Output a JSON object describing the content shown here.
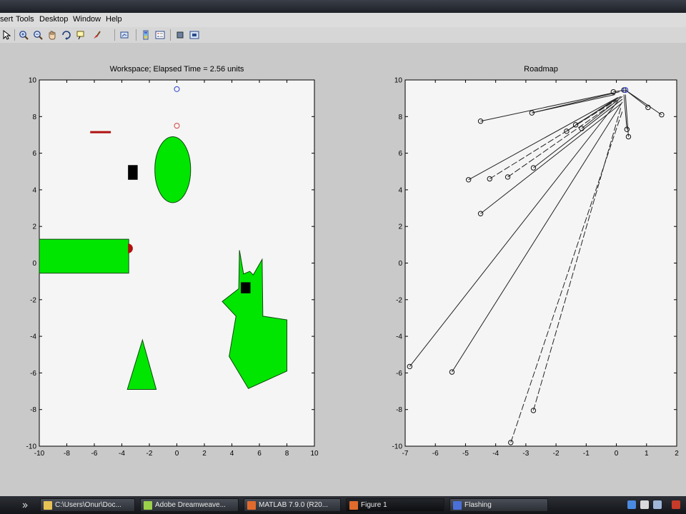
{
  "menu": {
    "items": [
      {
        "label": "sert"
      },
      {
        "label": "Tools"
      },
      {
        "label": "Desktop"
      },
      {
        "label": "Window"
      },
      {
        "label": "Help"
      }
    ]
  },
  "toolbar": {
    "buttons": [
      {
        "icon": "arrow-pointer-icon"
      },
      {
        "icon": "zoom-in-icon"
      },
      {
        "icon": "zoom-out-icon"
      },
      {
        "icon": "pan-hand-icon"
      },
      {
        "icon": "rotate-3d-icon"
      },
      {
        "icon": "data-cursor-icon"
      },
      {
        "icon": "brush-icon"
      },
      {
        "icon": "link-plot-icon"
      },
      {
        "icon": "colorbar-icon"
      },
      {
        "icon": "legend-icon"
      },
      {
        "icon": "hide-plot-tools-icon"
      },
      {
        "icon": "show-plot-tools-icon"
      }
    ]
  },
  "colors": {
    "obstacle": "#00e600",
    "block": "#000000",
    "robot": "#b01010",
    "goal": "#3040d0",
    "start": "#d04040",
    "axes_bg": "#f4f5f4",
    "figure_bg": "#c9c9c9"
  },
  "chart_data": [
    {
      "type": "scatter",
      "title": "Workspace; Elapsed Time = 2.56 units",
      "xlim": [
        -10,
        10
      ],
      "ylim": [
        -10,
        10
      ],
      "xticks": [
        -10,
        -8,
        -6,
        -4,
        -2,
        0,
        2,
        4,
        6,
        8,
        10
      ],
      "yticks": [
        -10,
        -8,
        -6,
        -4,
        -2,
        0,
        2,
        4,
        6,
        8,
        10
      ],
      "grid": false,
      "obstacles": [
        {
          "shape": "ellipse",
          "center": [
            -0.3,
            5.1
          ],
          "radii": [
            1.3,
            1.8
          ]
        },
        {
          "shape": "polygon",
          "points": [
            [
              -10,
              1.3
            ],
            [
              -3.5,
              1.3
            ],
            [
              -3.5,
              -0.55
            ],
            [
              -10,
              -0.55
            ]
          ]
        },
        {
          "shape": "polygon",
          "points": [
            [
              -3.6,
              -6.9
            ],
            [
              -2.5,
              -4.2
            ],
            [
              -1.5,
              -6.9
            ]
          ]
        },
        {
          "shape": "polygon",
          "points": [
            [
              4.55,
              0.7
            ],
            [
              4.85,
              -0.6
            ],
            [
              5.3,
              -0.45
            ],
            [
              5.55,
              -0.65
            ],
            [
              6.2,
              0.2
            ],
            [
              6.25,
              -2.9
            ],
            [
              8.0,
              -3.1
            ],
            [
              8.0,
              -5.9
            ],
            [
              5.2,
              -6.85
            ],
            [
              3.8,
              -5.1
            ],
            [
              4.3,
              -2.9
            ],
            [
              3.3,
              -2.1
            ],
            [
              4.5,
              -1.4
            ]
          ]
        }
      ],
      "blocks": [
        {
          "center": [
            -3.2,
            4.95
          ],
          "size": [
            0.7,
            0.8
          ]
        },
        {
          "center": [
            5.0,
            -1.35
          ],
          "size": [
            0.7,
            0.6
          ]
        }
      ],
      "robots": [
        {
          "shape": "segment",
          "from": [
            -6.3,
            7.15
          ],
          "to": [
            -4.8,
            7.15
          ]
        },
        {
          "shape": "half-disc",
          "center": [
            -3.55,
            0.8
          ],
          "radius": 0.35
        }
      ],
      "markers": [
        {
          "name": "goal",
          "x": 0.0,
          "y": 9.5
        },
        {
          "name": "start",
          "x": 0.0,
          "y": 7.5
        }
      ]
    },
    {
      "type": "line",
      "title": "Roadmap",
      "xlim": [
        -7,
        2
      ],
      "ylim": [
        -10,
        10
      ],
      "xticks": [
        -7,
        -6,
        -5,
        -4,
        -3,
        -2,
        -1,
        0,
        1,
        2
      ],
      "yticks": [
        -10,
        -8,
        -6,
        -4,
        -2,
        0,
        2,
        4,
        6,
        8,
        10
      ],
      "grid": false,
      "hub": [
        0.3,
        9.45
      ],
      "nodes": [
        {
          "x": -4.5,
          "y": 7.75
        },
        {
          "x": -2.8,
          "y": 8.2
        },
        {
          "x": -4.9,
          "y": 4.55
        },
        {
          "x": -4.2,
          "y": 4.6
        },
        {
          "x": -3.6,
          "y": 4.7
        },
        {
          "x": -2.75,
          "y": 5.2
        },
        {
          "x": -4.5,
          "y": 2.7
        },
        {
          "x": -1.65,
          "y": 7.2
        },
        {
          "x": -1.35,
          "y": 7.55
        },
        {
          "x": -1.15,
          "y": 7.35
        },
        {
          "x": -6.85,
          "y": -5.65
        },
        {
          "x": -5.45,
          "y": -5.95
        },
        {
          "x": -2.75,
          "y": -8.05
        },
        {
          "x": -3.5,
          "y": -9.8
        },
        {
          "x": 1.05,
          "y": 8.5
        },
        {
          "x": 1.5,
          "y": 8.1
        },
        {
          "x": 0.35,
          "y": 7.3
        },
        {
          "x": 0.4,
          "y": 6.9
        },
        {
          "x": -0.1,
          "y": 9.35
        },
        {
          "x": 0.25,
          "y": 9.45
        }
      ],
      "edges": [
        {
          "from": 0,
          "to": [
            -0.1,
            9.3
          ],
          "dash": false
        },
        {
          "from": 1,
          "to": [
            0.1,
            9.35
          ],
          "dash": false
        },
        {
          "from": 1,
          "to": [
            -0.05,
            9.2
          ],
          "dash": false
        },
        {
          "from": 2,
          "to": [
            0.0,
            9.0
          ],
          "dash": false
        },
        {
          "from": 3,
          "to": [
            0.0,
            8.9
          ],
          "dash": true
        },
        {
          "from": 4,
          "to": [
            0.1,
            8.95
          ],
          "dash": true
        },
        {
          "from": 5,
          "to": [
            0.2,
            8.95
          ],
          "dash": false
        },
        {
          "from": 6,
          "to": [
            0.15,
            8.7
          ],
          "dash": false
        },
        {
          "from": 7,
          "to": [
            0.05,
            9.05
          ],
          "dash": false
        },
        {
          "from": 8,
          "to": [
            0.15,
            9.1
          ],
          "dash": false
        },
        {
          "from": 9,
          "to": [
            0.2,
            9.1
          ],
          "dash": false
        },
        {
          "from": 10,
          "to": [
            0.05,
            8.85
          ],
          "dash": false
        },
        {
          "from": 11,
          "to": [
            0.2,
            8.8
          ],
          "dash": false
        },
        {
          "from": 12,
          "to": [
            0.15,
            8.5
          ],
          "dash": true
        },
        {
          "from": 13,
          "to": [
            0.2,
            8.3
          ],
          "dash": true
        },
        {
          "from": 14,
          "to": [
            0.3,
            9.45
          ],
          "dash": false
        },
        {
          "from": 15,
          "to": [
            0.3,
            9.45
          ],
          "dash": false
        },
        {
          "from": 16,
          "to": [
            0.25,
            9.2
          ],
          "dash": false
        },
        {
          "from": 17,
          "to": [
            0.3,
            9.2
          ],
          "dash": false
        },
        {
          "from": 18,
          "to": [
            0.3,
            9.45
          ],
          "dash": false
        }
      ],
      "hub_marker": {
        "x": 0.3,
        "y": 9.45
      }
    }
  ],
  "taskbar": {
    "items": [
      {
        "label": "C:\\Users\\Onur\\Doc...",
        "color": "#e6c255"
      },
      {
        "label": "Adobe Dreamweave...",
        "color": "#9ad04a"
      },
      {
        "label": "MATLAB 7.9.0 (R20...",
        "color": "#e06b2d"
      },
      {
        "label": "Figure 1",
        "color": "#e06b2d",
        "active": true
      },
      {
        "label": "Flashing",
        "color": "#4a70d8"
      }
    ],
    "tray_icons": [
      {
        "icon": "shield-tray-icon",
        "color": "#4a8adf"
      },
      {
        "icon": "network-tray-icon",
        "color": "#d9d9d9"
      },
      {
        "icon": "volume-tray-icon",
        "color": "#9fb6d8"
      },
      {
        "icon": "antivirus-tray-icon",
        "color": "#c83a2a"
      }
    ]
  }
}
